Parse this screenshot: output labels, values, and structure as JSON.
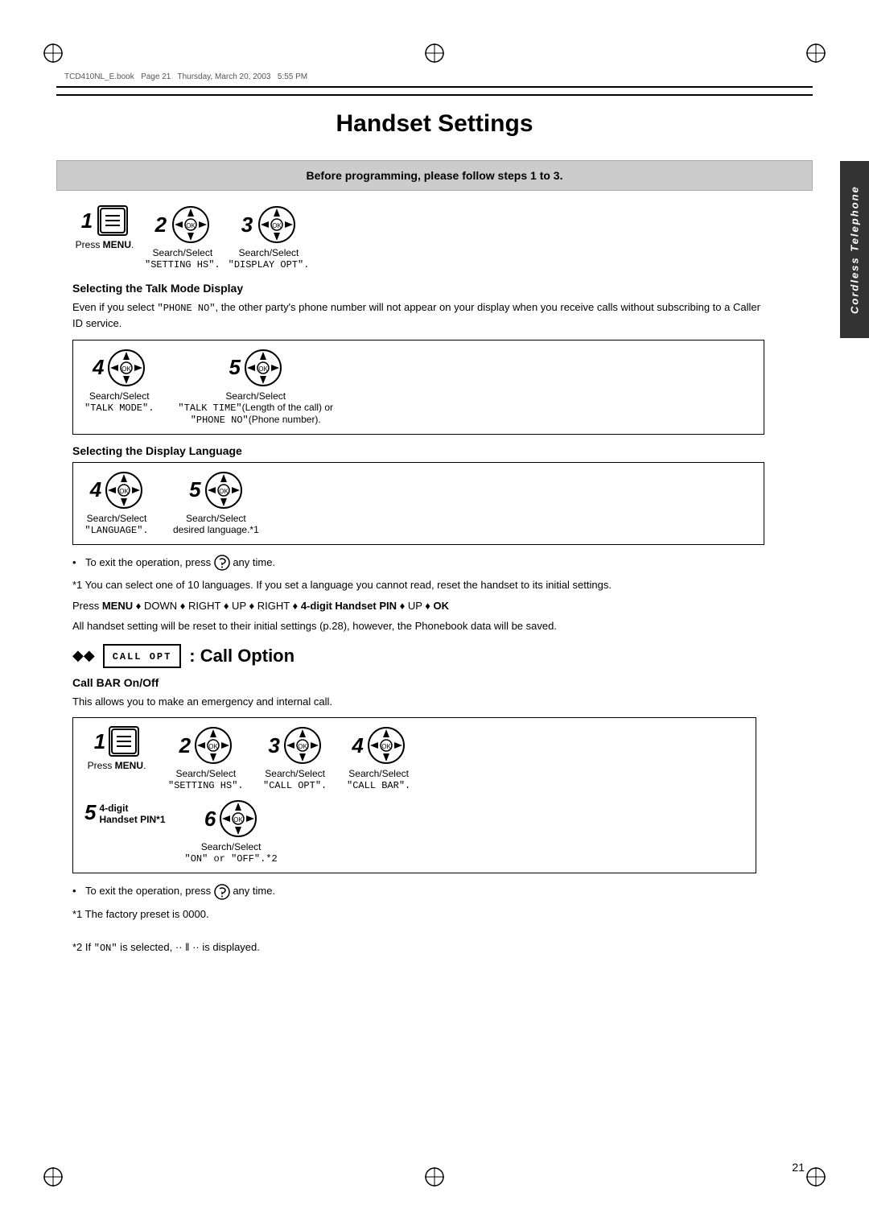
{
  "meta": {
    "filename": "TCD410NL_E.book",
    "page_info": "Page 21",
    "date": "Thursday, March 20, 2003",
    "time": "5:55 PM"
  },
  "title": "Handset Settings",
  "prereq": "Before programming, please follow steps 1 to 3.",
  "steps_intro": [
    {
      "num": "1",
      "icon": "menu-button",
      "label": "Press MENU."
    },
    {
      "num": "2",
      "icon": "dpad",
      "label": "Search/Select\n\"SETTING HS\"."
    },
    {
      "num": "3",
      "icon": "dpad",
      "label": "Search/Select\n\"DISPLAY OPT\"."
    }
  ],
  "section_talk_mode": {
    "heading": "Selecting the Talk Mode Display",
    "body": "Even if you select \"PHONE NO\", the other party's phone number will not appear on your display when you receive calls without subscribing to a Caller ID service.",
    "steps": [
      {
        "num": "4",
        "icon": "dpad",
        "label": "Search/Select\n\"TALK MODE\"."
      },
      {
        "num": "5",
        "icon": "dpad",
        "label": "Search/Select\n\"TALK TIME\"(Length of the call) or\n\"PHONE NO\"(Phone number)."
      }
    ]
  },
  "section_display_lang": {
    "heading": "Selecting the Display Language",
    "steps": [
      {
        "num": "4",
        "icon": "dpad",
        "label": "Search/Select\n\"LANGUAGE\"."
      },
      {
        "num": "5",
        "icon": "dpad",
        "label": "Search/Select\ndesired language.*1"
      }
    ]
  },
  "notes_display": [
    "To exit the operation, press Ⓞ any time.",
    "*1 You can select one of 10 languages. If you set a language you cannot read, reset the handset to its initial settings.",
    "Press MENU ♦ DOWN ♦ RIGHT ♦ UP ♦ RIGHT ♦ 4-digit Handset PIN ♦ UP ♦ OK",
    "All handset setting will be reset to their initial settings (p.28), however, the Phonebook data will be saved."
  ],
  "call_option": {
    "lcd_text": "CALL OPT",
    "title": ": Call Option",
    "subsection": {
      "heading": "Call BAR On/Off",
      "body": "This allows you to make an emergency and internal call.",
      "steps": [
        {
          "num": "1",
          "icon": "menu-button",
          "label": "Press MENU."
        },
        {
          "num": "2",
          "icon": "dpad",
          "label": "Search/Select\n\"SETTING HS\"."
        },
        {
          "num": "3",
          "icon": "dpad",
          "label": "Search/Select\n\"CALL OPT\"."
        },
        {
          "num": "4",
          "icon": "dpad",
          "label": "Search/Select\n\"CALL BAR\"."
        }
      ],
      "step5": {
        "num": "5",
        "label_bold": "4-digit\nHandset PIN*1"
      },
      "step6": {
        "num": "6",
        "icon": "dpad",
        "label": "Search/Select\n\"ON\" or \"OFF\".*2"
      }
    },
    "notes": [
      "To exit the operation, press Ⓞ any time.",
      "*1 The factory preset is 0000.",
      "",
      "*2 If \"ON\" is selected, ·· ∥ ·· is displayed."
    ]
  },
  "sidebar_text": "Cordless Telephone",
  "page_number": "21"
}
